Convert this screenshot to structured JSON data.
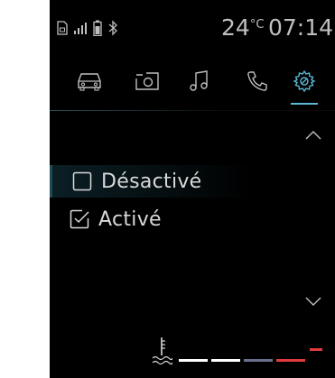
{
  "status_bar": {
    "icons": [
      "sim-icon",
      "signal-icon",
      "battery-icon",
      "bluetooth-icon"
    ],
    "temperature_value": "24",
    "temperature_unit": "°C",
    "time": "07:14"
  },
  "tabs": [
    {
      "name": "car",
      "active": false
    },
    {
      "name": "camera",
      "active": false
    },
    {
      "name": "music",
      "active": false
    },
    {
      "name": "phone",
      "active": false
    },
    {
      "name": "settings",
      "active": true
    }
  ],
  "options": [
    {
      "label": "Désactivé",
      "checked": false,
      "selected": true
    },
    {
      "label": "Activé",
      "checked": true,
      "selected": false
    }
  ],
  "gauge": {
    "icon": "coolant-temperature-icon",
    "levels": [
      "#ffffff",
      "#ffffff",
      "#6a6f8e",
      "#e23b3b"
    ]
  },
  "colors": {
    "accent": "#59b9d6",
    "text": "#d9d9d9",
    "warning": "#e23b3b"
  }
}
